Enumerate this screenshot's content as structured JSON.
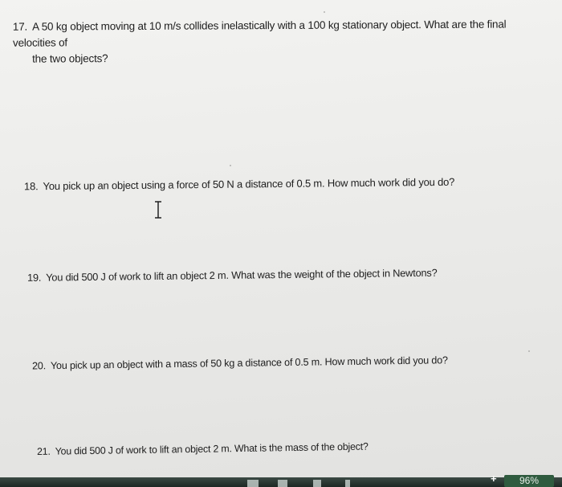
{
  "questions": [
    {
      "number": "17.",
      "line1": "A 50 kg object moving at 10 m/s collides inelastically with a 100 kg stationary object. What are the final velocities of",
      "line2": "the two objects?"
    },
    {
      "number": "18.",
      "text": "You pick up an object using a force of 50 N a distance of 0.5 m. How much work did you do?"
    },
    {
      "number": "19.",
      "text": "You did 500 J of work to lift an object 2 m. What was the weight of the object in Newtons?"
    },
    {
      "number": "20.",
      "text": "You pick up an object with a mass of 50 kg a distance of 0.5 m. How much work did you do?"
    },
    {
      "number": "21.",
      "text": "You did 500 J of work to lift an object 2 m. What is the mass of the object?"
    }
  ],
  "cursor": {
    "icon": "text-cursor-icon"
  },
  "taskbar": {
    "add_symbol": "+",
    "zoom": "96%",
    "bg_color": "#1d2824",
    "zoom_color": "#2f5b3f"
  }
}
